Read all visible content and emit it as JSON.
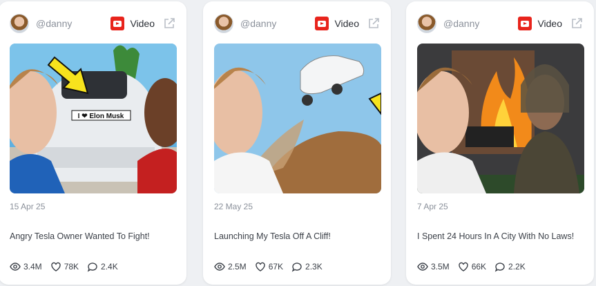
{
  "cards": [
    {
      "handle": "@danny",
      "type_label": "Video",
      "date": "15 Apr 25",
      "title": "Angry Tesla Owner Wanted To Fight!",
      "thumb_text": "I ❤ Elon Musk",
      "views": "3.4M",
      "likes": "78K",
      "comments": "2.4K"
    },
    {
      "handle": "@danny",
      "type_label": "Video",
      "date": "22 May 25",
      "title": "Launching My Tesla Off A Cliff!",
      "views": "2.5M",
      "likes": "67K",
      "comments": "2.3K"
    },
    {
      "handle": "@danny",
      "type_label": "Video",
      "date": "7 Apr 25",
      "title": "I Spent 24 Hours In A City With No Laws!",
      "views": "3.5M",
      "likes": "66K",
      "comments": "2.2K"
    }
  ],
  "colors": {
    "youtube_red": "#e8241c",
    "muted_text": "#8a909a",
    "body_text": "#3a3f47"
  },
  "icons": {
    "platform": "youtube-icon",
    "external": "external-link-icon",
    "views": "eye-icon",
    "likes": "heart-icon",
    "comments": "comment-icon"
  }
}
